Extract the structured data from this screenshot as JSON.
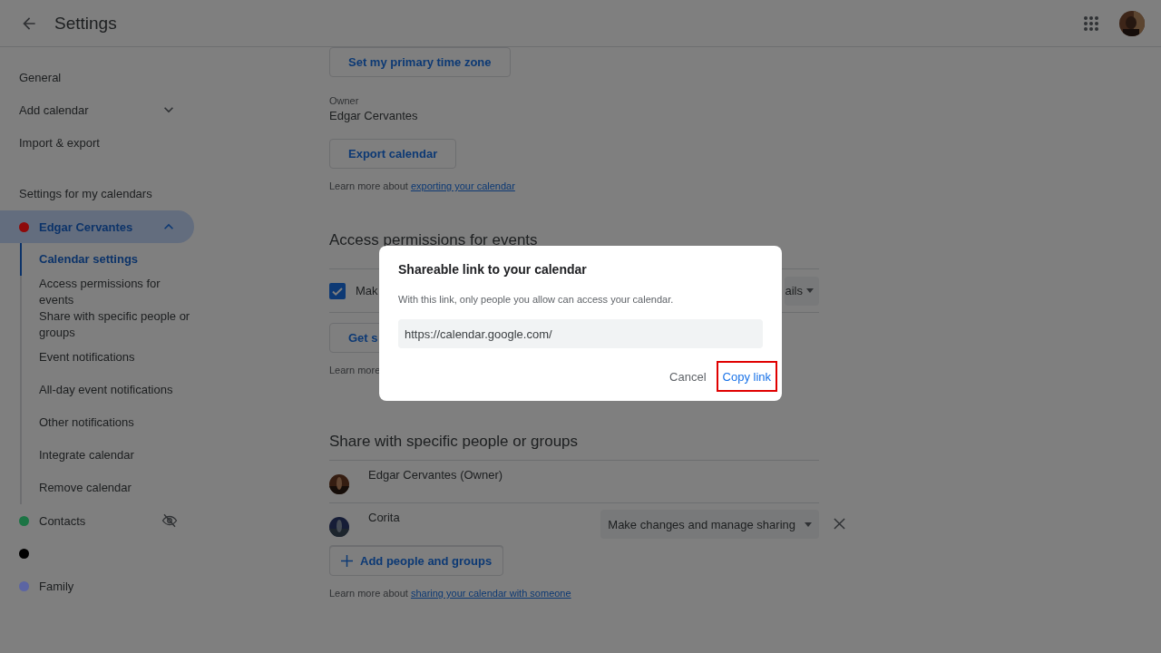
{
  "header": {
    "title": "Settings"
  },
  "sidebar": {
    "top_items": [
      {
        "label": "General"
      },
      {
        "label": "Add calendar",
        "expanded": false
      },
      {
        "label": "Import & export"
      }
    ],
    "section_title": "Settings for my calendars",
    "calendars": [
      {
        "name": "Edgar Cervantes",
        "color": "#8e0a0a",
        "selected": true,
        "expanded": true,
        "children": [
          {
            "label": "Calendar settings",
            "selected": true
          },
          {
            "label": "Access permissions for events",
            "selected": false
          },
          {
            "label": "Share with specific people or groups",
            "selected": false
          },
          {
            "label": "Event notifications",
            "selected": false
          },
          {
            "label": "All-day event notifications",
            "selected": false
          },
          {
            "label": "Other notifications",
            "selected": false
          },
          {
            "label": "Integrate calendar",
            "selected": false
          },
          {
            "label": "Remove calendar",
            "selected": false
          }
        ]
      },
      {
        "name": "Contacts",
        "color": "#1c7444",
        "selected": false,
        "hidden": true
      },
      {
        "color": "#000000",
        "selected": false
      },
      {
        "name": "Family",
        "color": "#5c65a3",
        "selected": false
      }
    ]
  },
  "main": {
    "time_zone_button": "Set my primary time zone",
    "owner_label": "Owner",
    "owner": "Edgar Cervantes",
    "export_button": "Export calendar",
    "export_note": {
      "text": "Learn more about ",
      "link": "exporting your calendar"
    },
    "access": {
      "title": "Access permissions for events",
      "checkbox": {
        "label": "Mak",
        "checked": true
      },
      "dropdown": "ails",
      "link_button": "Get s",
      "note": "Learn more"
    },
    "share": {
      "title": "Share with specific people or groups",
      "people": [
        {
          "name": "Edgar Cervantes (Owner)"
        },
        {
          "name": "Corita",
          "permission": "Make changes and manage sharing",
          "removable": true
        }
      ],
      "add_button": "Add people and groups",
      "note": {
        "text": "Learn more about ",
        "link": "sharing your calendar with someone"
      }
    }
  },
  "dialog": {
    "title": "Shareable link to your calendar",
    "text": "With this link, only people you allow can access your calendar.",
    "url": "https://calendar.google.com/",
    "buttons": [
      {
        "label": "Cancel",
        "highlighted": false
      },
      {
        "label": "Copy link",
        "highlighted": true
      }
    ]
  }
}
